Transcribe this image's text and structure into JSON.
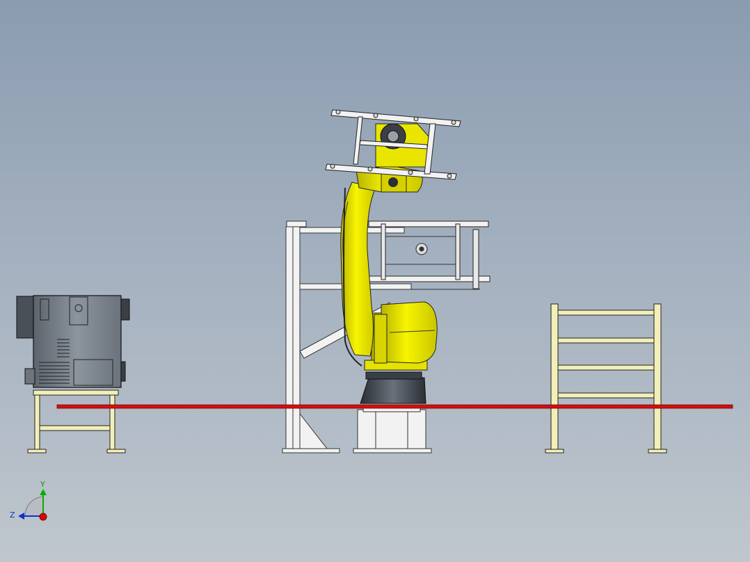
{
  "viewport": {
    "background_top": "#8b9cb0",
    "background_bottom": "#bfc6cd"
  },
  "colors": {
    "robot_yellow": "#f4f000",
    "rail_red": "#d01010",
    "fence_cream": "#f2efb8",
    "frame_white": "#f2f2f2",
    "cabinet_grey": "#7d8590"
  },
  "triad": {
    "y_label": "Y",
    "z_label": "Z",
    "y_color": "#00b000",
    "z_color": "#1030d0",
    "x_color": "#e00000"
  },
  "icons": [
    "coordinate-triad-icon"
  ]
}
